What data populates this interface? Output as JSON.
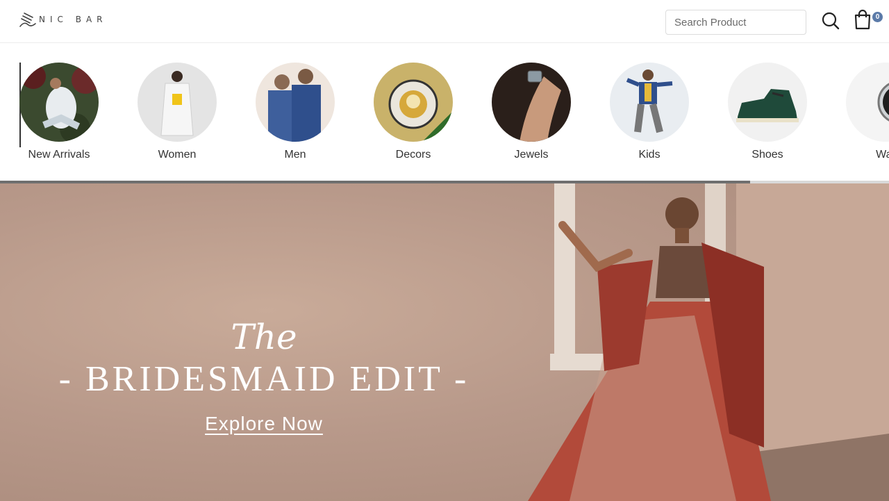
{
  "header": {
    "logo_text": "NIC BAR",
    "search_placeholder": "Search Product",
    "search_icon": "search-icon",
    "cart_icon": "shopping-bag-icon",
    "cart_count": "0"
  },
  "categories": [
    {
      "label": "New Arrivals"
    },
    {
      "label": "Women"
    },
    {
      "label": "Men"
    },
    {
      "label": "Decors"
    },
    {
      "label": "Jewels"
    },
    {
      "label": "Kids"
    },
    {
      "label": "Shoes"
    },
    {
      "label": "Wat"
    }
  ],
  "hero": {
    "title_small": "The",
    "title_main": "- BRIDESMAID EDIT -",
    "cta": "Explore Now"
  },
  "colors": {
    "hero_wall": "#b8998a",
    "accent_badge": "#5b7aa8"
  }
}
